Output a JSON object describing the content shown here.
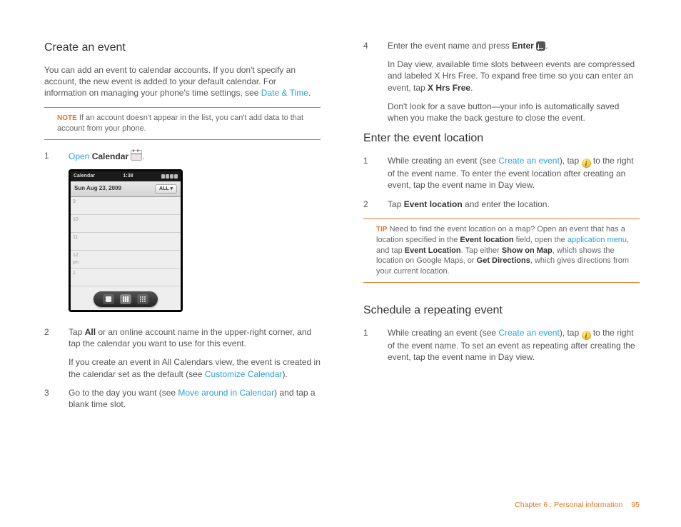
{
  "left": {
    "h1": "Create an event",
    "intro_a": "You can add an event to calendar accounts. If you don't specify an account, the new event is added to your default calendar. For information on managing your phone's time settings, see ",
    "intro_link": "Date & Time",
    "intro_c": ".",
    "note_label": "NOTE",
    "note_text": "  If an account doesn't appear in the list, you can't add data to that account from your phone.",
    "s1_num": "1",
    "s1_open": "Open",
    "s1_cal": " Calendar ",
    "s1_end": ".",
    "phone": {
      "top_left": "Calendar",
      "top_time": "1:38",
      "date": "Sun Aug 23, 2009",
      "all": "ALL ▾",
      "hours": [
        "9",
        "10",
        "11",
        "12",
        "1"
      ],
      "pm": "pm"
    },
    "s2_num": "2",
    "s2_a": "Tap ",
    "s2_all": "All",
    "s2_b": " or an online account name in the upper-right corner, and tap the calendar you want to use for this event.",
    "s2_para2_a": "If you create an event in All Calendars view, the event is created in the calendar set as the default (see ",
    "s2_para2_link": "Customize Calendar",
    "s2_para2_c": ").",
    "s3_num": "3",
    "s3_a": "Go to the day you want (see ",
    "s3_link": "Move around in Calendar",
    "s3_b": ") and tap a blank time slot."
  },
  "right": {
    "s4_num": "4",
    "s4_a": "Enter the event name and press ",
    "s4_enter": "Enter",
    "s4_b": " ",
    "s4_c": ".",
    "s4_p2_a": "In Day view, available time slots between events are compressed and labeled X Hrs Free. To expand free time so you can enter an event, tap ",
    "s4_p2_bold": "X Hrs Free",
    "s4_p2_b": ".",
    "s4_p3": "Don't look for a save button—your info is automatically saved when you make the back gesture to close the event.",
    "h2": "Enter the event location",
    "loc1_num": "1",
    "loc1_a": "While creating an event (see ",
    "loc1_link": "Create an event",
    "loc1_b": "), tap ",
    "loc1_c": " to the right of the event name. To enter the event location after creating an event, tap the event name in Day view.",
    "loc2_num": "2",
    "loc2_a": "Tap ",
    "loc2_bold": "Event location",
    "loc2_b": " and enter the location.",
    "tip_label": "TIP",
    "tip_a": "  Need to find the event location on a map? Open an event that has a location specified in the ",
    "tip_b1": "Event location",
    "tip_c": " field, open the ",
    "tip_link": "application menu",
    "tip_d": ", and tap ",
    "tip_b2": "Event Location",
    "tip_e": ". Tap either ",
    "tip_b3": "Show on Map",
    "tip_f": ", which shows the location on Google Maps, or ",
    "tip_b4": "Get Directions",
    "tip_g": ", which gives directions from your current location.",
    "h3": "Schedule a repeating event",
    "rep1_num": "1",
    "rep1_a": "While creating an event (see ",
    "rep1_link": "Create an event",
    "rep1_b": "), tap ",
    "rep1_c": " to the right of the event name. To set an event as repeating after creating the event, tap the event name in Day view."
  },
  "footer": {
    "chapter": "Chapter 6  :  Personal information",
    "page": "95"
  }
}
